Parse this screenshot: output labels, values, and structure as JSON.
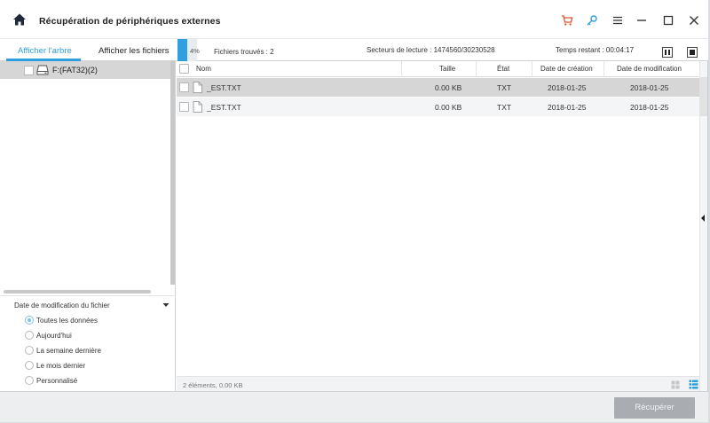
{
  "window": {
    "title": "Récupération de périphériques externes"
  },
  "icons": {
    "home": "home-icon",
    "cart": "cart-icon",
    "key": "key-icon",
    "menu": "menu-icon",
    "minimize": "minimize-icon",
    "maximize": "maximize-icon",
    "close": "close-icon",
    "drive": "drive-icon",
    "file": "file-icon",
    "grid_view": "grid-view-icon",
    "list_view": "list-view-icon"
  },
  "colors": {
    "accent": "#2ea0e0",
    "cart": "#e0502a",
    "key": "#2ea0e0",
    "selected_row": "#d6d6d6",
    "button_disabled": "#a9adb2"
  },
  "toolbar": {
    "tab_tree": "Afficher l'arbre",
    "tab_files": "Afficher les fichiers",
    "progress_percent": "4%",
    "progress_fraction": 0.04,
    "found": "Fichiers trouvés :  2",
    "sectors": "Secteurs de lecture :  1474560/30230528",
    "remaining": "Temps restant : 00:04:17"
  },
  "tree": {
    "items": [
      {
        "label": "F:(FAT32)(2)"
      }
    ]
  },
  "filter": {
    "title": "Date de modification du fichier",
    "options": [
      {
        "label": "Toutes les données",
        "checked": true
      },
      {
        "label": "Aujourd'hui",
        "checked": false
      },
      {
        "label": "La semaine dernière",
        "checked": false
      },
      {
        "label": "Le mois dernier",
        "checked": false
      },
      {
        "label": "Personnalisé",
        "checked": false
      }
    ]
  },
  "table": {
    "columns": [
      "Nom",
      "Taille",
      "État",
      "Date de création",
      "Date de modification"
    ],
    "rows": [
      {
        "name": "_EST.TXT",
        "size": "0.00 KB",
        "type": "TXT",
        "created": "2018-01-25",
        "modified": "2018-01-25"
      },
      {
        "name": "_EST.TXT",
        "size": "0.00 KB",
        "type": "TXT",
        "created": "2018-01-25",
        "modified": "2018-01-25"
      }
    ]
  },
  "status": {
    "text": "2 éléments, 0.00 KB"
  },
  "footer": {
    "recover_label": "Récupérer"
  }
}
